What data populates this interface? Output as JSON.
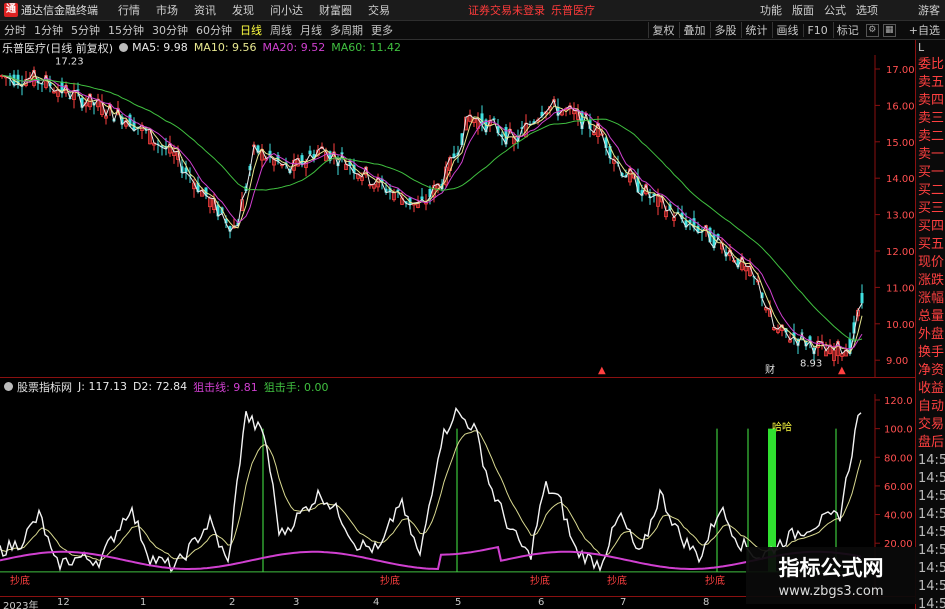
{
  "app": {
    "logo": "通",
    "title": "通达信金融终端"
  },
  "menu": [
    "行情",
    "市场",
    "资讯",
    "发现",
    "问小达",
    "财富圈",
    "交易"
  ],
  "login_status": "证券交易未登录",
  "stock_title": "乐普医疗",
  "top_right": [
    "功能",
    "版面",
    "公式",
    "选项"
  ],
  "guest": "游客",
  "periods": [
    {
      "label": "分时",
      "active": false
    },
    {
      "label": "1分钟",
      "active": false
    },
    {
      "label": "5分钟",
      "active": false
    },
    {
      "label": "15分钟",
      "active": false
    },
    {
      "label": "30分钟",
      "active": false
    },
    {
      "label": "60分钟",
      "active": false
    },
    {
      "label": "日线",
      "active": true
    },
    {
      "label": "周线",
      "active": false
    },
    {
      "label": "月线",
      "active": false
    },
    {
      "label": "多周期",
      "active": false
    },
    {
      "label": "更多",
      "active": false
    }
  ],
  "tools": [
    "复权",
    "叠加",
    "多股",
    "统计",
    "画线",
    "F10",
    "标记"
  ],
  "add_watch": "+自选",
  "main_info": {
    "name": "乐普医疗(日线 前复权)",
    "ma": [
      {
        "text": "MA5: 9.98",
        "color": "#e8e8e8"
      },
      {
        "text": "MA10: 9.56",
        "color": "#e8e890"
      },
      {
        "text": "MA20: 9.52",
        "color": "#d040d0"
      },
      {
        "text": "MA60: 11.42",
        "color": "#40c040"
      }
    ]
  },
  "indicator_info": {
    "name": "股票指标网",
    "items": [
      {
        "text": "J: 117.13",
        "color": "#e8e8e8"
      },
      {
        "text": "D2: 72.84",
        "color": "#e8e8e8"
      },
      {
        "text": "狙击线: 9.81",
        "color": "#d040d0"
      },
      {
        "text": "狙击手: 0.00",
        "color": "#40c040"
      }
    ]
  },
  "main_axis": {
    "labels": [
      "17.00",
      "16.00",
      "15.00",
      "14.00",
      "13.00",
      "12.00",
      "11.00",
      "10.00",
      "9.00"
    ],
    "max": "17.23",
    "min": "8.93"
  },
  "ind_axis": {
    "labels": [
      "120.0",
      "100.0",
      "80.00",
      "60.00",
      "40.00",
      "20.00"
    ]
  },
  "signal_text": "哈哈",
  "bottom_signals": [
    "抄底",
    "抄底",
    "抄底",
    "抄底",
    "抄底"
  ],
  "main_markers": [
    "▲",
    "财",
    "▲"
  ],
  "date_ticks": [
    "2023年",
    "12",
    "1",
    "2",
    "3",
    "4",
    "5",
    "6",
    "7",
    "8"
  ],
  "right_col": {
    "head": "L",
    "items": [
      "委比",
      "卖五",
      "卖四",
      "卖三",
      "卖二",
      "卖一",
      "买一",
      "买二",
      "买三",
      "买四",
      "买五",
      "现价",
      "涨跌",
      "涨幅",
      "总量",
      "外盘",
      "换手",
      "净资",
      "收益",
      "自动",
      "交易",
      "盘后",
      "14:59",
      "14:59",
      "14:59",
      "14:59",
      "14:59",
      "14:59",
      "14:59",
      "14:59",
      "14:59"
    ]
  },
  "watermark": {
    "title": "指标公式网",
    "url": "www.zbgs3.com"
  }
}
